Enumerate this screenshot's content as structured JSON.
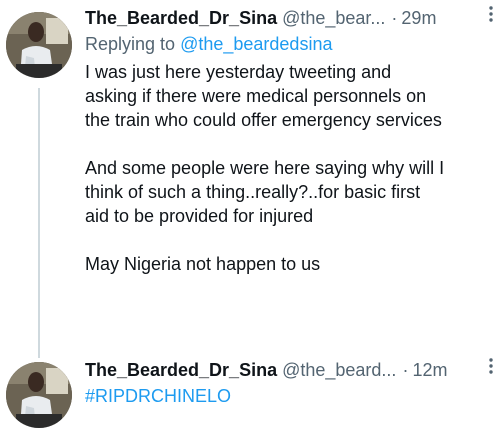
{
  "tweets": [
    {
      "author_name": "The_Bearded_Dr_Sina",
      "handle": "@the_bear...",
      "dot": "·",
      "time": "29m",
      "replying_prefix": "Replying to",
      "replying_handle": "@the_beardedsina",
      "paragraphs": [
        "I was just here yesterday tweeting and\nasking if there were medical personnels on\nthe train who could offer emergency services",
        "And some people were here saying why will I\nthink of such a thing..really?..for basic first\naid to be provided for injured",
        "May Nigeria not happen to us"
      ],
      "more_icon": "more-vertical-icon"
    },
    {
      "author_name": "The_Bearded_Dr_Sina",
      "handle": "@the_beard...",
      "dot": "·",
      "time": "12m",
      "hashtag": "#RIPDRCHINELO",
      "more_icon": "more-vertical-icon"
    }
  ],
  "colors": {
    "link": "#1d9bf0",
    "secondary_text": "#536471",
    "primary_text": "#0f1419",
    "thread_line": "#cfd9de"
  }
}
